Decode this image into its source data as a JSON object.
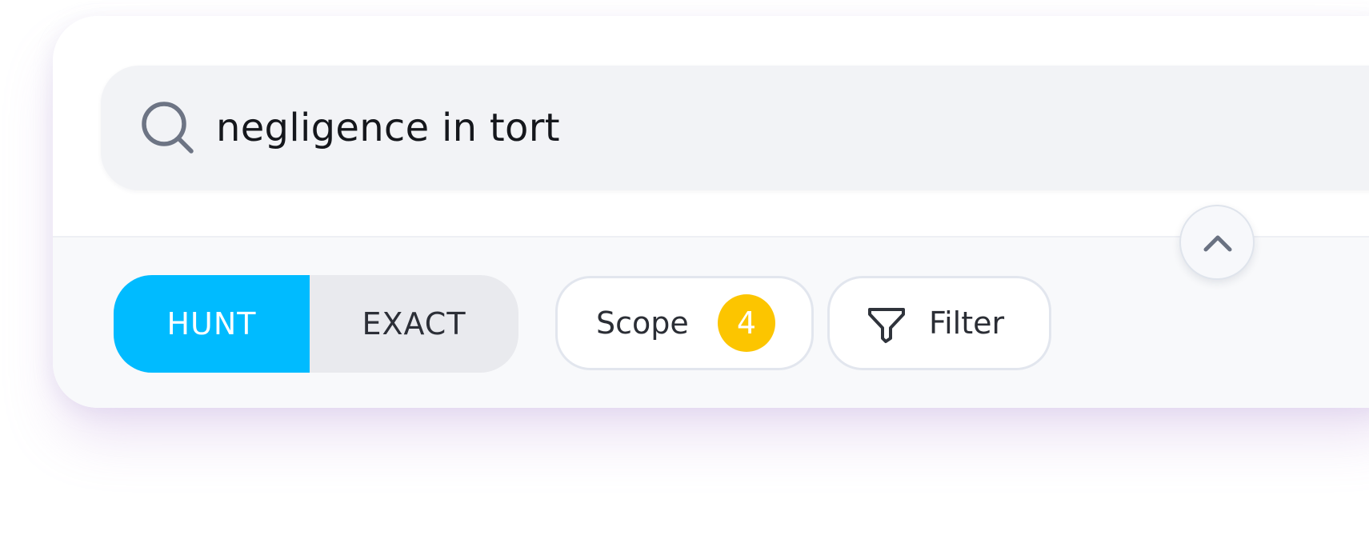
{
  "search": {
    "query": "negligence in tort",
    "icon": "search-icon"
  },
  "mode_toggle": {
    "options": [
      {
        "label": "HUNT",
        "selected": true
      },
      {
        "label": "EXACT",
        "selected": false
      }
    ],
    "active_color": "#00BBFF"
  },
  "scope": {
    "label": "Scope",
    "count": "4",
    "badge_color": "#FCC500"
  },
  "filter": {
    "label": "Filter",
    "icon": "funnel-icon"
  },
  "collapse": {
    "icon": "chevron-up-icon"
  }
}
